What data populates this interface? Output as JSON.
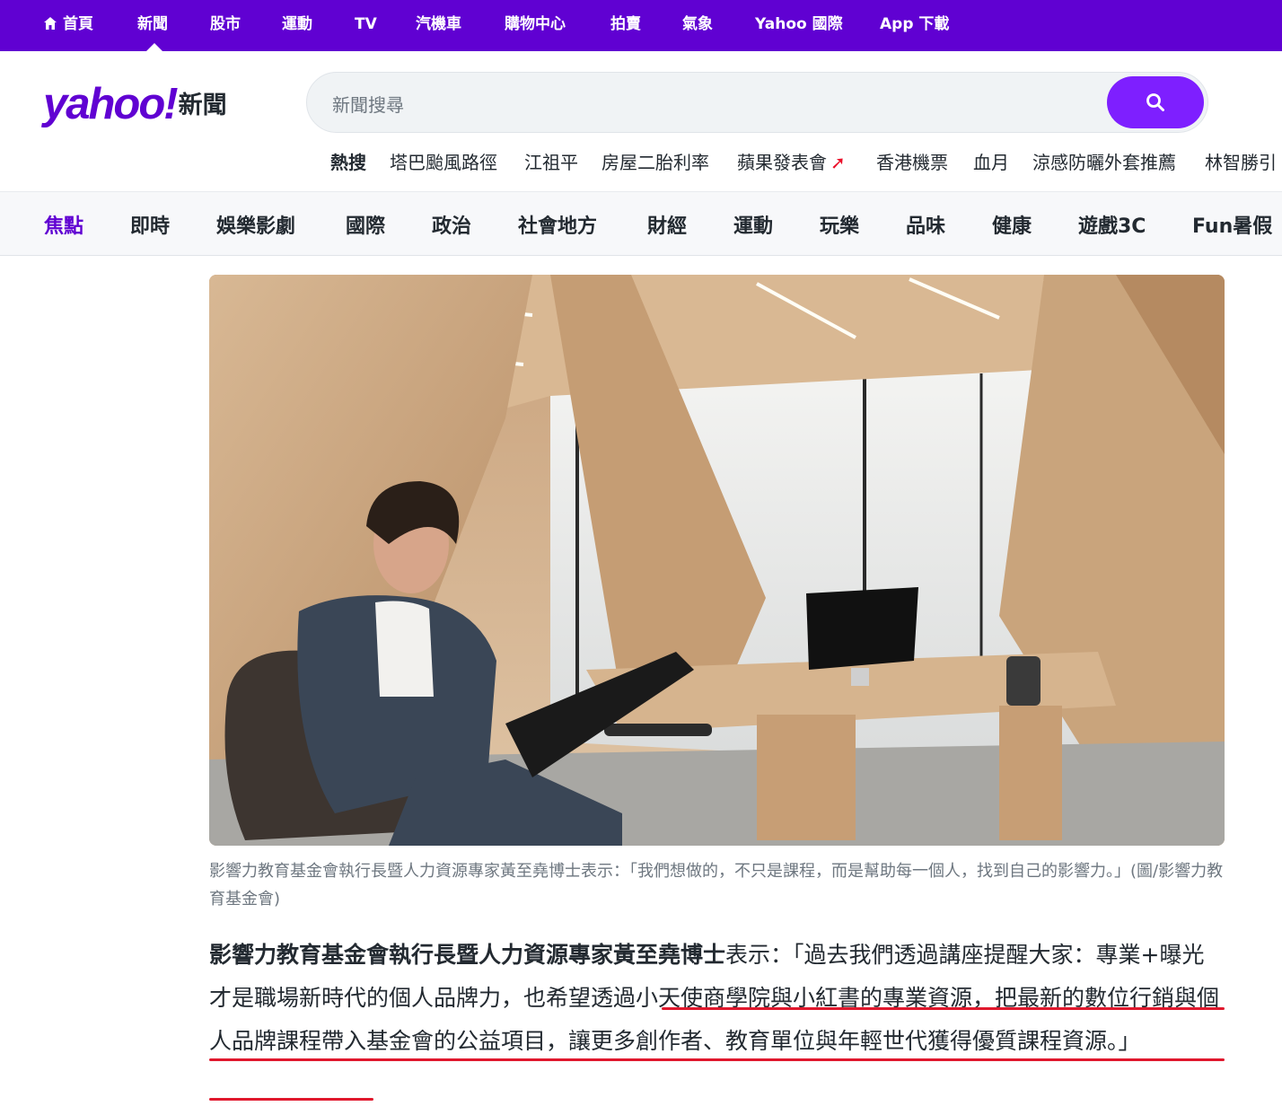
{
  "topnav": {
    "items": [
      "首頁",
      "新聞",
      "股市",
      "運動",
      "TV",
      "汽機車",
      "購物中心",
      "拍賣",
      "氣象",
      "Yahoo 國際",
      "App 下載"
    ],
    "home_icon": "house-icon",
    "active": "新聞"
  },
  "header": {
    "logo_brand": "yahoo!",
    "logo_section": "新聞",
    "search_placeholder": "新聞搜尋",
    "search_icon": "search-icon",
    "trending_label": "熱搜",
    "trending": [
      "塔巴颱風路徑",
      "江祖平",
      "房屋二胎利率",
      "蘋果發表會",
      "香港機票",
      "血月",
      "涼感防曬外套推薦",
      "林智勝引"
    ],
    "trending_up_icon": "arrow-up-icon"
  },
  "categories": {
    "items": [
      "焦點",
      "即時",
      "娛樂影劇",
      "國際",
      "政治",
      "社會地方",
      "財經",
      "運動",
      "玩樂",
      "品味",
      "健康",
      "遊戲3C",
      "Fun暑假"
    ],
    "active": "焦點"
  },
  "article": {
    "image_alt": "man seated in armchair with laptop in a wood-paneled office",
    "caption": "影響力教育基金會執行長暨人力資源專家黃至堯博士表示：「我們想做的，不只是課程，而是幫助每一個人，找到自己的影響力。」(圖/影響力教育基金會)",
    "para_bold": "影響力教育基金會執行長暨人力資源專家黃至堯博士",
    "para_text": "表示：「過去我們透過講座提醒大家：專業+曝光才是職場新時代的個人品牌力，也",
    "para_highlight": "希望透過小天使商學院與小紅書的專業資源，把最新的數位行銷與個人品牌課程帶入基金會的公益項目，讓更多創作者、教育單位與年輕世代獲得優質課程資源。",
    "para_end": "」"
  },
  "colors": {
    "brand": "#6001d2",
    "search_button": "#7e1fff",
    "underline": "#e0182d",
    "trend_arrow": "#eb0f29"
  }
}
